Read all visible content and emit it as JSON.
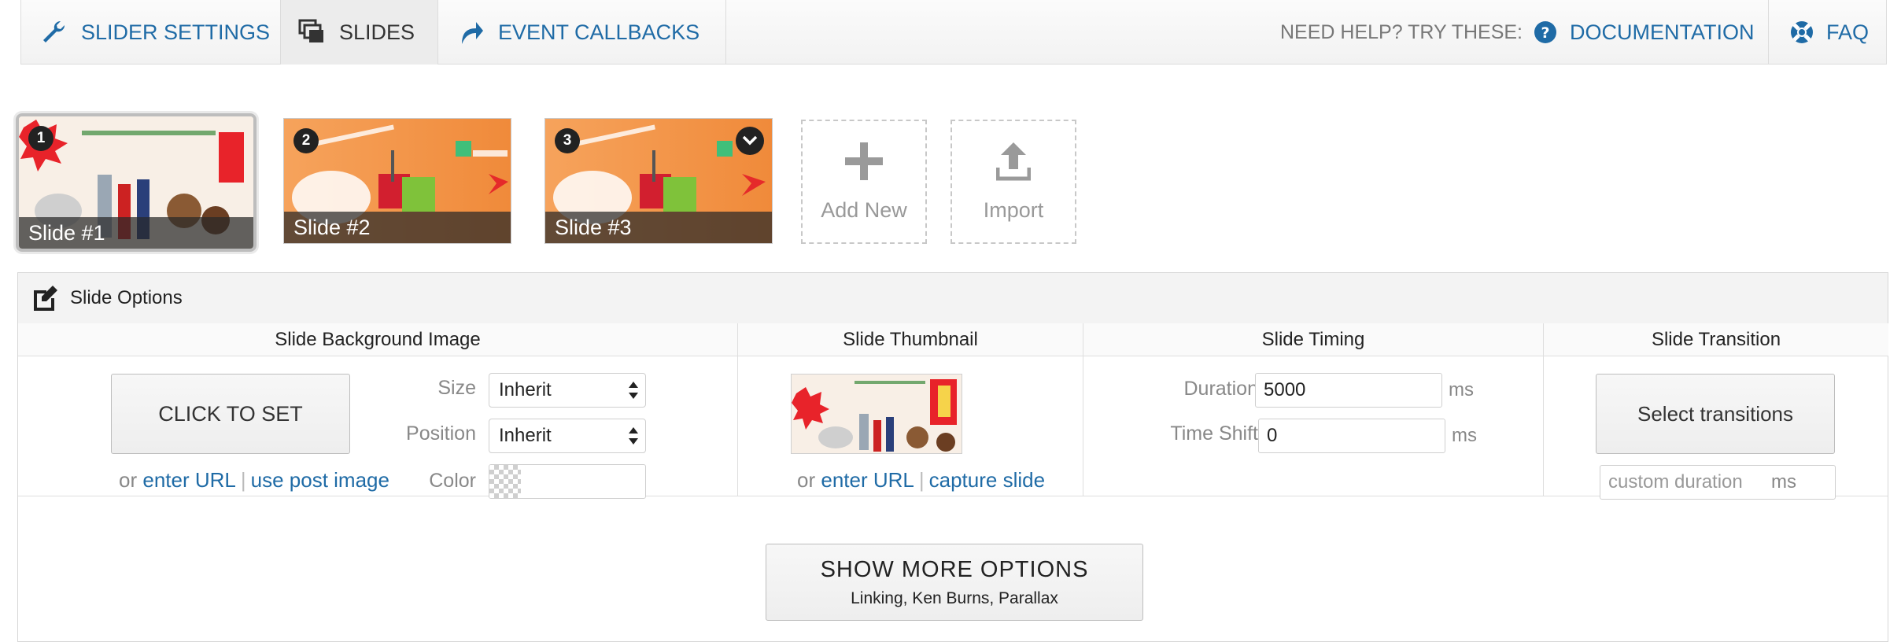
{
  "nav": {
    "tabs": [
      {
        "label": "SLIDER SETTINGS",
        "icon": "wrench-icon"
      },
      {
        "label": "SLIDES",
        "icon": "slides-icon",
        "active": true
      },
      {
        "label": "EVENT CALLBACKS",
        "icon": "redo-arrow-icon"
      }
    ],
    "help_text": "NEED HELP? TRY THESE:",
    "documentation": "DOCUMENTATION",
    "faq": "FAQ"
  },
  "slides": [
    {
      "number": "1",
      "caption": "Slide #1",
      "selected": true
    },
    {
      "number": "2",
      "caption": "Slide #2"
    },
    {
      "number": "3",
      "caption": "Slide #3"
    }
  ],
  "actions": {
    "add_new": "Add New",
    "import": "Import"
  },
  "slide_options": {
    "title": "Slide Options",
    "background": {
      "heading": "Slide Background Image",
      "click_to_set": "CLICK TO SET",
      "or": "or",
      "enter_url": "enter URL",
      "use_post_image": "use post image",
      "size_label": "Size",
      "size_value": "Inherit",
      "position_label": "Position",
      "position_value": "Inherit",
      "color_label": "Color"
    },
    "thumbnail": {
      "heading": "Slide Thumbnail",
      "or": "or",
      "enter_url": "enter URL",
      "capture_slide": "capture slide"
    },
    "timing": {
      "heading": "Slide Timing",
      "duration_label": "Duration",
      "duration_value": "5000",
      "time_shift_label": "Time Shift",
      "time_shift_value": "0",
      "unit": "ms"
    },
    "transition": {
      "heading": "Slide Transition",
      "select_transitions": "Select transitions",
      "custom_duration_placeholder": "custom duration",
      "unit": "ms"
    },
    "more": {
      "title": "SHOW MORE OPTIONS",
      "subtitle": "Linking, Ken Burns, Parallax"
    }
  },
  "colors": {
    "link": "#1f6ba6",
    "label": "#888888",
    "border": "#d7d7d7",
    "slide_orange": "#f5a96a"
  }
}
